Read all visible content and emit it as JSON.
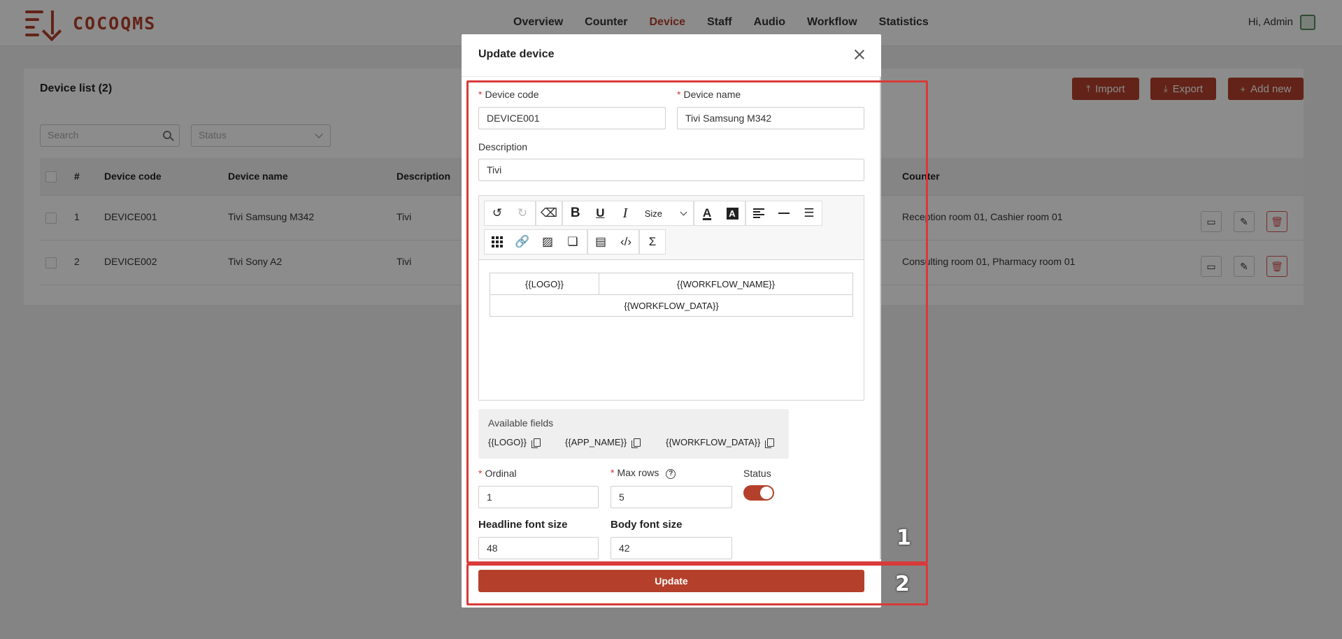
{
  "brand": {
    "name": "COCOQMS"
  },
  "nav": [
    "Overview",
    "Counter",
    "Device",
    "Staff",
    "Audio",
    "Workflow",
    "Statistics"
  ],
  "nav_active": "Device",
  "user": {
    "greeting": "Hi, Admin"
  },
  "list": {
    "title": "Device list (2)",
    "buttons": {
      "import": "Import",
      "export": "Export",
      "add_new": "Add new"
    },
    "search_placeholder": "Search",
    "status_placeholder": "Status",
    "columns": {
      "index": "#",
      "code": "Device code",
      "name": "Device name",
      "description": "Description",
      "counter": "Counter"
    },
    "rows": [
      {
        "index": "1",
        "code": "DEVICE001",
        "name": "Tivi Samsung M342",
        "description": "Tivi",
        "counter": "Reception room 01, Cashier room 01"
      },
      {
        "index": "2",
        "code": "DEVICE002",
        "name": "Tivi Sony A2",
        "description": "Tivi",
        "counter": "Consulting room 01, Pharmacy room 01"
      }
    ]
  },
  "modal": {
    "title": "Update device",
    "device_code_label": "Device code",
    "device_code_value": "DEVICE001",
    "device_name_label": "Device name",
    "device_name_value": "Tivi Samsung M342",
    "description_label": "Description",
    "description_value": "Tivi",
    "editor": {
      "size_label": "Size",
      "table": {
        "logo": "{{LOGO}}",
        "workflow_name": "{{WORKFLOW_NAME}}",
        "workflow_data": "{{WORKFLOW_DATA}}"
      }
    },
    "available_fields_title": "Available fields",
    "available_fields": [
      "{{LOGO}}",
      "{{APP_NAME}}",
      "{{WORKFLOW_DATA}}"
    ],
    "ordinal_label": "Ordinal",
    "ordinal_value": "1",
    "max_rows_label": "Max rows",
    "max_rows_value": "5",
    "status_label": "Status",
    "status_on": true,
    "headline_font_label": "Headline font size",
    "headline_font_value": "48",
    "body_font_label": "Body font size",
    "body_font_value": "42",
    "update_button": "Update"
  },
  "annotations": [
    "1",
    "2"
  ],
  "colors": {
    "accent": "#b4402c",
    "annotation": "#d93a3a"
  }
}
